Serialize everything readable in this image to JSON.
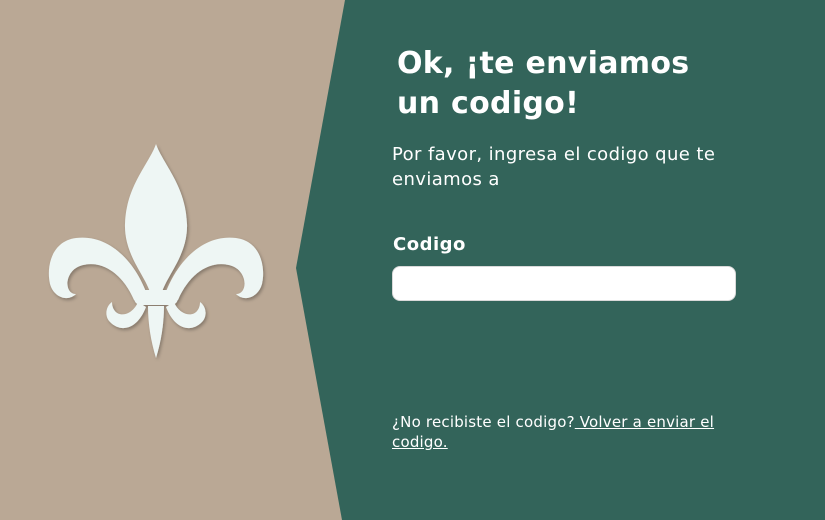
{
  "colors": {
    "left_panel": "#baa895",
    "right_panel": "#33645a",
    "logo": "#eef6f4",
    "text": "#ffffff"
  },
  "logo": {
    "icon": "fleur-de-lis-icon"
  },
  "form": {
    "title": "Ok, ¡te enviamos un codigo!",
    "subtitle": "Por favor, ingresa el codigo que te enviamos a",
    "code_label": "Codigo",
    "code_value": "",
    "code_placeholder": "",
    "resend_prompt": "¿No recibiste el codigo?",
    "resend_link": " Volver a enviar el codigo."
  }
}
